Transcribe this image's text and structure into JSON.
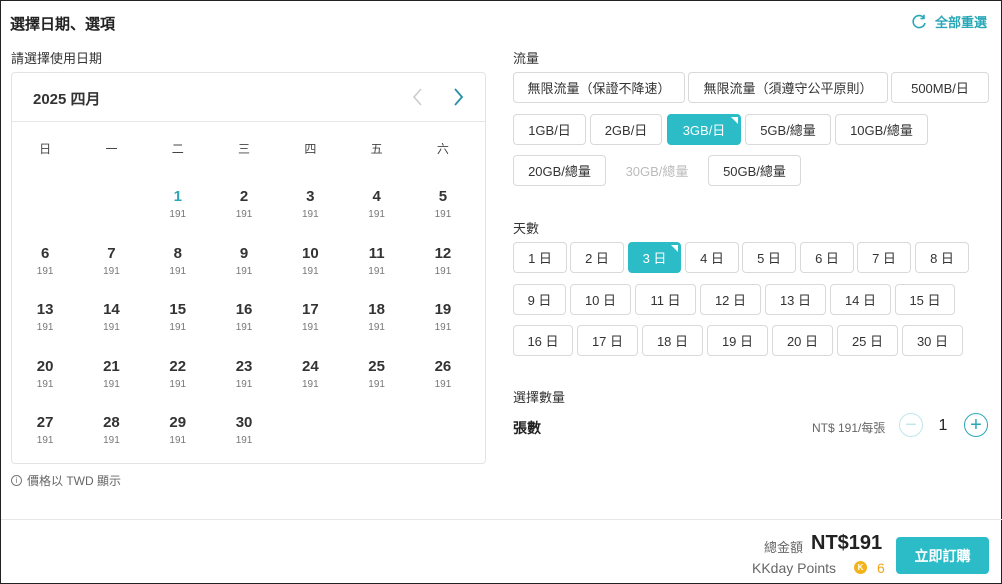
{
  "header": {
    "title": "選擇日期、選項",
    "reset_label": "全部重選",
    "reset_icon": "refresh-icon"
  },
  "calendar": {
    "label": "請選擇使用日期",
    "month_title": "2025 四月",
    "weekdays": [
      "日",
      "一",
      "二",
      "三",
      "四",
      "五",
      "六"
    ],
    "leading_blanks": 2,
    "days": [
      {
        "day": "1",
        "price": "191"
      },
      {
        "day": "2",
        "price": "191"
      },
      {
        "day": "3",
        "price": "191"
      },
      {
        "day": "4",
        "price": "191"
      },
      {
        "day": "5",
        "price": "191"
      },
      {
        "day": "6",
        "price": "191"
      },
      {
        "day": "7",
        "price": "191"
      },
      {
        "day": "8",
        "price": "191"
      },
      {
        "day": "9",
        "price": "191"
      },
      {
        "day": "10",
        "price": "191"
      },
      {
        "day": "11",
        "price": "191"
      },
      {
        "day": "12",
        "price": "191"
      },
      {
        "day": "13",
        "price": "191"
      },
      {
        "day": "14",
        "price": "191"
      },
      {
        "day": "15",
        "price": "191"
      },
      {
        "day": "16",
        "price": "191"
      },
      {
        "day": "17",
        "price": "191"
      },
      {
        "day": "18",
        "price": "191"
      },
      {
        "day": "19",
        "price": "191"
      },
      {
        "day": "20",
        "price": "191"
      },
      {
        "day": "21",
        "price": "191"
      },
      {
        "day": "22",
        "price": "191"
      },
      {
        "day": "23",
        "price": "191"
      },
      {
        "day": "24",
        "price": "191"
      },
      {
        "day": "25",
        "price": "191"
      },
      {
        "day": "26",
        "price": "191"
      },
      {
        "day": "27",
        "price": "191"
      },
      {
        "day": "28",
        "price": "191"
      },
      {
        "day": "29",
        "price": "191"
      },
      {
        "day": "30",
        "price": "191"
      }
    ],
    "active_day": "1",
    "note": "價格以 TWD 顯示"
  },
  "traffic": {
    "label": "流量",
    "options": [
      "無限流量（保證不降速）",
      "無限流量（須遵守公平原則）",
      "500MB/日",
      "1GB/日",
      "2GB/日",
      "3GB/日",
      "5GB/總量",
      "10GB/總量",
      "20GB/總量",
      "30GB/總量",
      "50GB/總量"
    ],
    "selected": "3GB/日",
    "disabled": [
      "30GB/總量"
    ]
  },
  "days_option": {
    "label": "天數",
    "options": [
      "1 日",
      "2 日",
      "3 日",
      "4 日",
      "5 日",
      "6 日",
      "7 日",
      "8 日",
      "9 日",
      "10 日",
      "11 日",
      "12 日",
      "13 日",
      "14 日",
      "15 日",
      "16 日",
      "17 日",
      "18 日",
      "19 日",
      "20 日",
      "25 日",
      "30 日"
    ],
    "selected": "3 日"
  },
  "quantity": {
    "label": "選擇數量",
    "item_title": "張數",
    "unit_price": "NT$ 191/每張",
    "value": "1"
  },
  "footer": {
    "total_label": "總金額",
    "total_value": "NT$191",
    "points_label": "KKday Points",
    "points_value": "6",
    "book_label": "立即訂購"
  },
  "colors": {
    "accent": "#2cbcc8",
    "points": "#f2b31b"
  }
}
